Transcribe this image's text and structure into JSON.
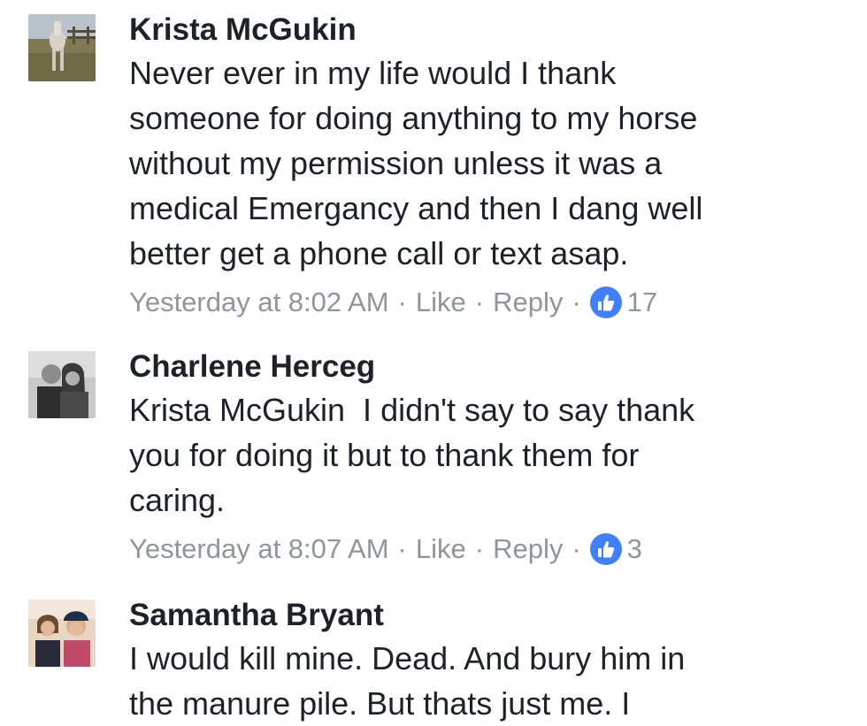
{
  "comments": [
    {
      "author": "Krista McGukin",
      "avatar_icon": "horse-photo-avatar",
      "lines": [
        "Never ever in my life would I thank",
        "someone for doing anything to my horse",
        "without my permission unless it was a",
        "medical Emergancy and then I dang well",
        "better get a phone call or text asap."
      ],
      "timestamp": "Yesterday at 8:02 AM",
      "separator": "·",
      "like_label": "Like",
      "reply_label": "Reply",
      "reaction_icon": "thumbs-up-icon",
      "reaction_count": "17"
    },
    {
      "author": "Charlene Herceg",
      "avatar_icon": "couple-photo-avatar",
      "lines": [
        "Krista McGukin  I didn't say to say thank",
        "you for doing it but to thank them for",
        "caring."
      ],
      "timestamp": "Yesterday at 8:07 AM",
      "separator": "·",
      "like_label": "Like",
      "reply_label": "Reply",
      "reaction_icon": "thumbs-up-icon",
      "reaction_count": "3"
    },
    {
      "author": "Samantha Bryant",
      "avatar_icon": "two-women-photo-avatar",
      "lines": [
        "I would kill mine. Dead. And bury him in",
        "the manure pile. But thats just me. I"
      ]
    }
  ],
  "colors": {
    "text": "#1d2129",
    "meta": "#90949c",
    "like_badge": "#4080ff"
  }
}
